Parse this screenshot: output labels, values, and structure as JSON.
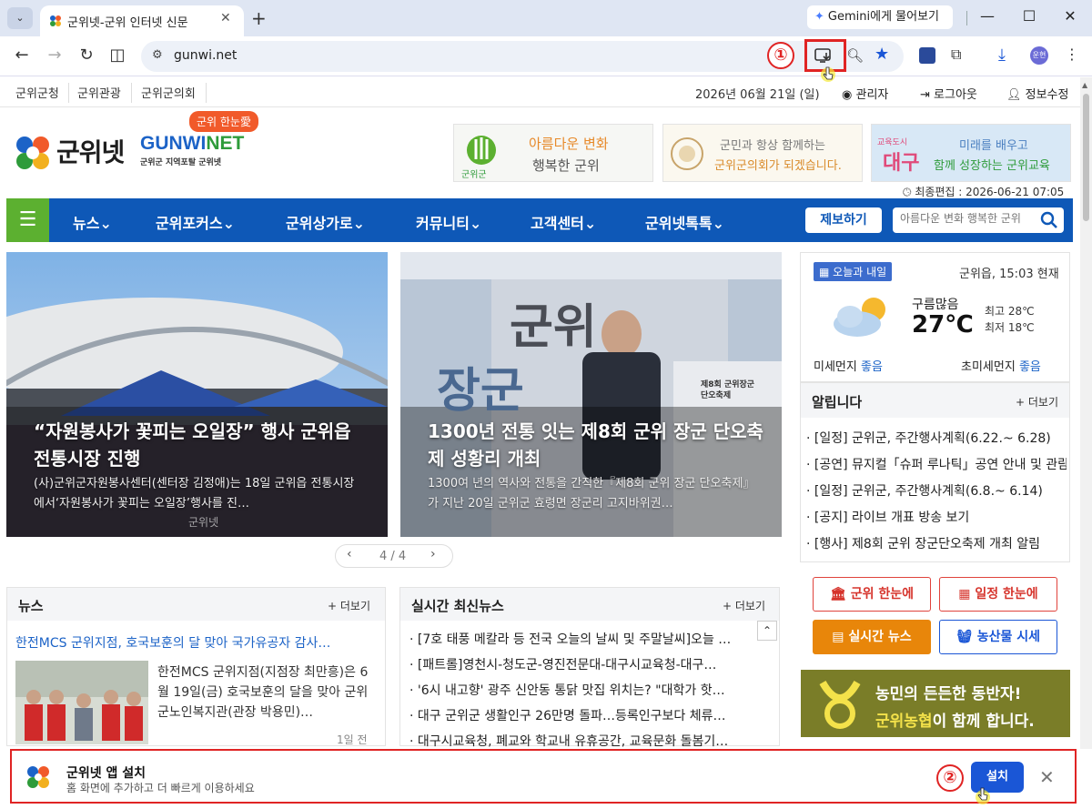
{
  "browser": {
    "tab_title": "군위넷-군위 인터넷 신문",
    "tab_close": "✕",
    "new_tab": "+",
    "gemini_label": "Gemini에게 물어보기",
    "url": "gunwi.net",
    "annotation_1": "①",
    "annotation_2": "②",
    "icons": [
      "tab-search-icon",
      "back-icon",
      "forward-icon",
      "reload-icon",
      "split-view-icon",
      "site-info-icon",
      "install-app-icon",
      "zoom-icon",
      "bookmark-star-icon",
      "extension-icon",
      "puzzle-icon",
      "download-icon",
      "profile-avatar",
      "menu-icon",
      "minimize-icon",
      "maximize-icon",
      "close-icon"
    ],
    "profile_initials": "운현"
  },
  "topbar": {
    "links": [
      "군위군청",
      "군위관광",
      "군위군의회"
    ],
    "date": "2026년 06월 21일 (일)",
    "admin": "관리자",
    "logout": "로그아웃",
    "edit_info": "정보수정"
  },
  "logo": {
    "bubble": "군위 한눈愛",
    "kor": "군위넷",
    "eng_a": "GUNWI",
    "eng_b": "NET",
    "sub": "군위군 지역포탈 군위넷"
  },
  "banners": {
    "b1_line1": "아름다운 변화",
    "b1_line2": "행복한 군위",
    "b1_logo": "군위군",
    "b2_line1": "군민과 항상 함께하는",
    "b2_line2": "군위군의회가 되겠습니다.",
    "b3_line1": "미래를 배우고",
    "b3_line2": "함께 성장하는 군위교육",
    "b3_logo_a": "교육도시",
    "b3_logo_b": "대구"
  },
  "last_edit": "최종편집 : 2026-06-21 07:05",
  "nav": {
    "items": [
      "뉴스",
      "군위포커스",
      "군위상가로",
      "커뮤니티",
      "고객센터",
      "군위넷톡톡"
    ],
    "report": "제보하기",
    "search_placeholder": "아름다운 변화 행복한 군위"
  },
  "slides": [
    {
      "title": "“자원봉사가 꽃피는 오일장” 행사 군위읍 전통시장 진행",
      "desc": "(사)군위군자원봉사센터(센터장 김정애)는 18일 군위읍 전통시장에서‘자원봉사가 꽃피는 오일장’행사를 진…",
      "watermark": "군위넷"
    },
    {
      "title": "1300년 전통 잇는 제8회 군위 장군 단오축제 성황리 개최",
      "desc": "1300여 년의 역사와 전통을 간직한『제8회 군위 장군 단오축제』가 지난 20일 군위군 효령면 장군리 고지바위권…",
      "sign_a": "군위",
      "sign_b": "장군",
      "sign_c": "제8회 군위장군단오축제"
    }
  ],
  "pager": {
    "text": "4 / 4",
    "prev": "‹",
    "next": "›"
  },
  "weather": {
    "tag": "오늘과 내일",
    "location": "군위읍, 15:03 현재",
    "condition": "구름많음",
    "temp": "27℃",
    "high": "최고 28℃",
    "low": "최저 18℃",
    "pm10_label": "미세먼지",
    "pm10_value": "좋음",
    "pm25_label": "초미세먼지",
    "pm25_value": "좋음"
  },
  "notice": {
    "title": "알립니다",
    "more": "+ 더보기",
    "items": [
      "[일정] 군위군, 주간행사계획(6.22.~ 6.28)",
      "[공연] 뮤지컬「슈퍼 루나틱」공연 안내 및 관람",
      "[일정] 군위군, 주간행사계획(6.8.~ 6.14)",
      "[공지] 라이브 개표 방송 보기",
      "[행사] 제8회 군위 장군단오축제 개최 알림"
    ]
  },
  "quick": {
    "q1": "군위 한눈에",
    "q2": "일정 한눈에",
    "q3": "실시간 뉴스",
    "q4": "농산물 시세"
  },
  "farm": {
    "line1": "농민의 든든한 동반자!",
    "line2_hl": "군위농협",
    "line2_rest": "이 함께 합니다."
  },
  "news": {
    "title": "뉴스",
    "more": "+ 더보기",
    "headline": "한전MCS 군위지점, 호국보훈의 달 맞아 국가유공자 감사…",
    "summary": "한전MCS 군위지점(지점장 최만흥)은 6월 19일(금) 호국보훈의 달을 맞아 군위군노인복지관(관장 박용민)…",
    "time": "1일 전"
  },
  "realtime": {
    "title": "실시간 최신뉴스",
    "more": "+ 더보기",
    "up": "⌃",
    "items": [
      "[7호 태풍 메칼라 등 전국 오늘의 날씨 및 주말날씨]오늘 …",
      "[패트롤]영천시-청도군-영진전문대-대구시교육청-대구…",
      "'6시 내고향' 광주 신안동 통닭 맛집 위치는? \"대학가 핫…",
      "대구 군위군 생활인구 26만명 돌파…등록인구보다 체류…",
      "대구시교육청, 폐교와 학교내 유휴공간, 교육문화 돌봄기…"
    ]
  },
  "install_bar": {
    "title": "군위넷 앱 설치",
    "desc": "홈 화면에 추가하고 더 빠르게 이용하세요",
    "button": "설치",
    "close": "✕"
  },
  "colors": {
    "nav_blue": "#0e58b7",
    "nav_green": "#5cb030",
    "annotation_red": "#e02424",
    "install_blue": "#1a56d6"
  }
}
